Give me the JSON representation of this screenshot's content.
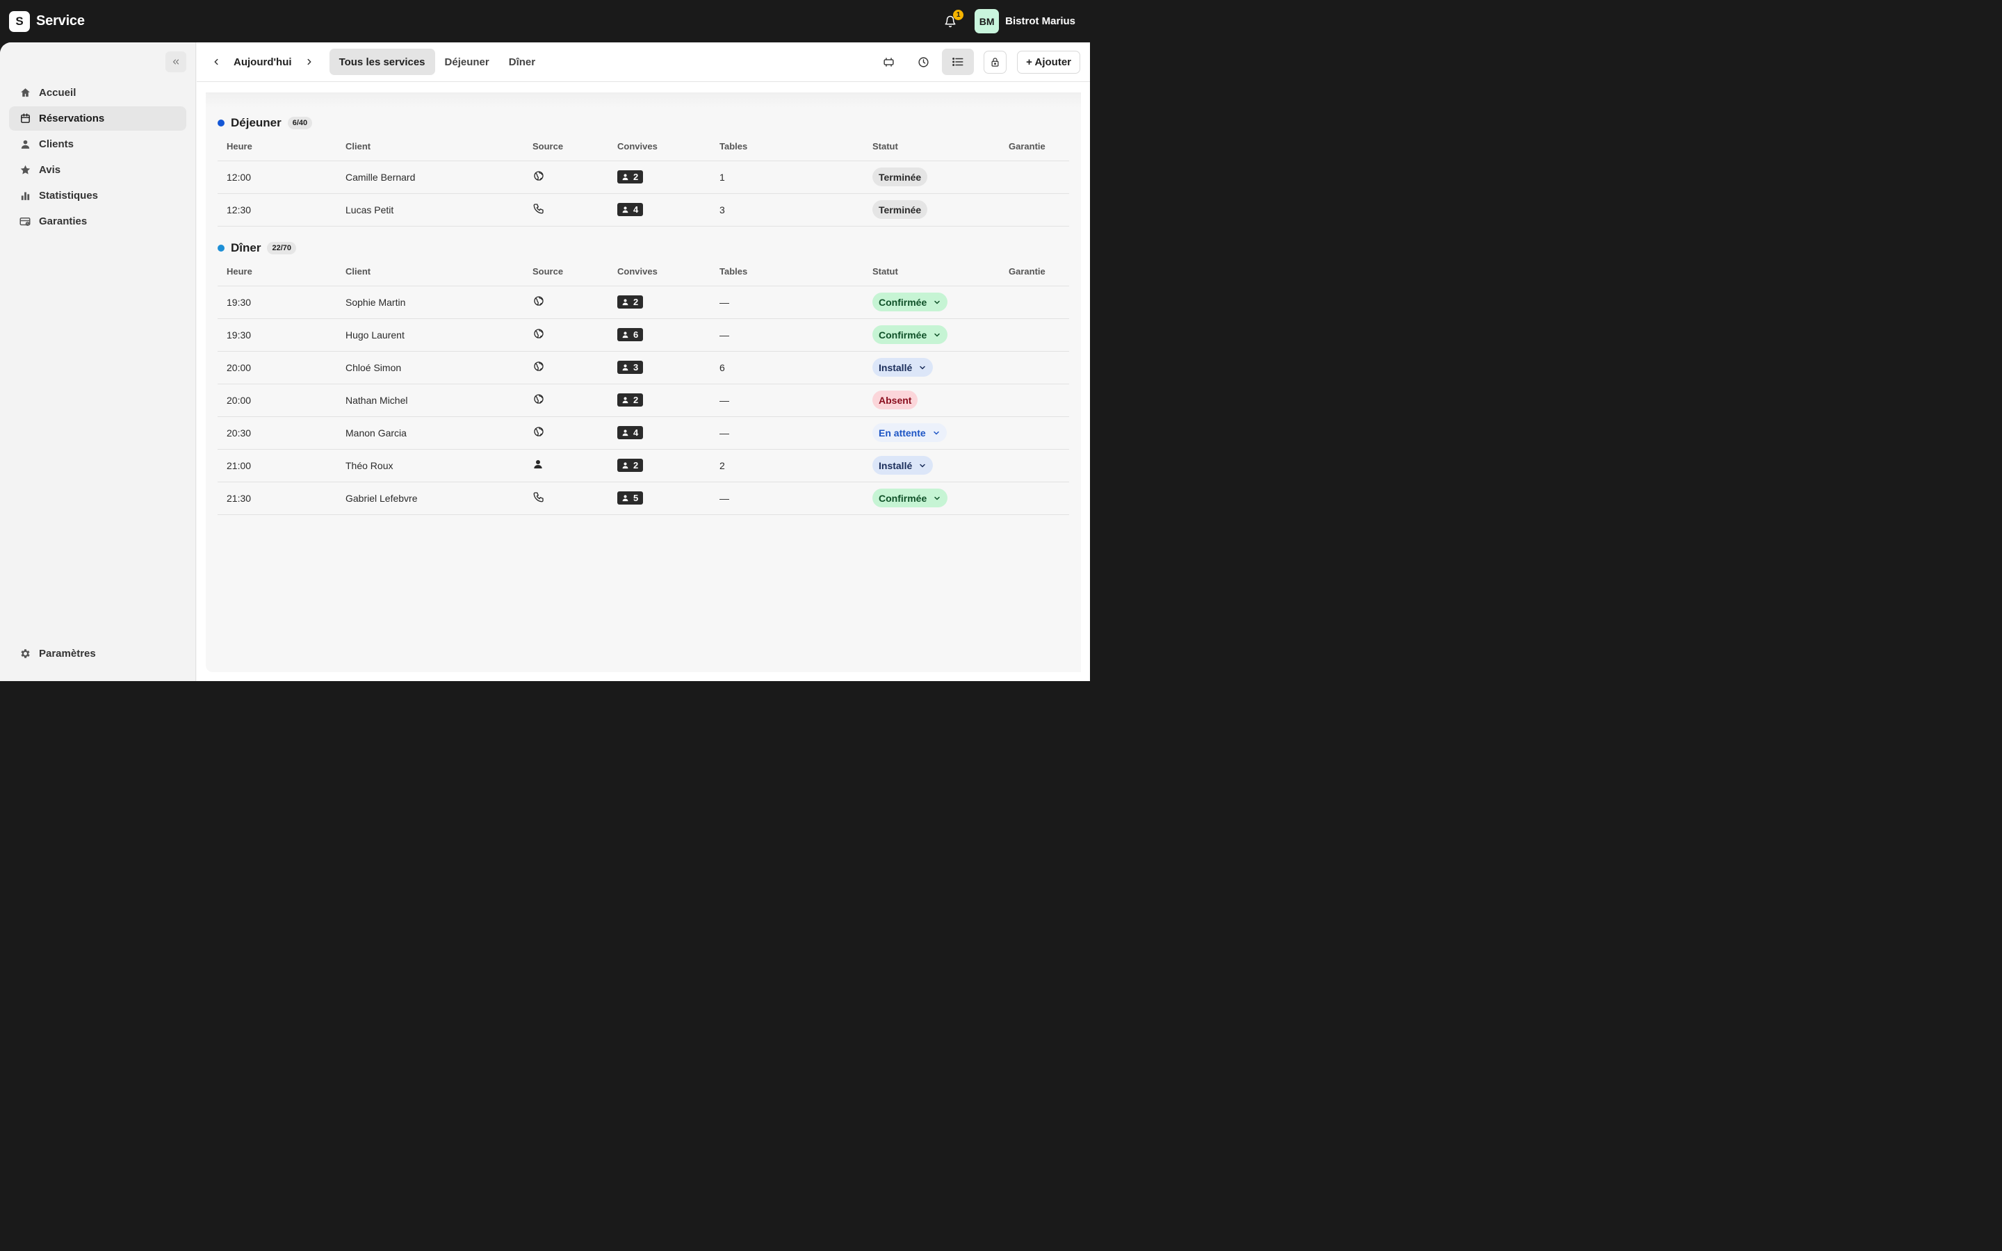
{
  "app": {
    "logo_letter": "S",
    "title": "Service"
  },
  "header": {
    "notif_count": "1",
    "avatar_initials": "BM",
    "account_name": "Bistrot Marius"
  },
  "sidebar": {
    "items": [
      {
        "label": "Accueil",
        "icon": "home-icon",
        "active": false
      },
      {
        "label": "Réservations",
        "icon": "calendar-icon",
        "active": true
      },
      {
        "label": "Clients",
        "icon": "user-icon",
        "active": false
      },
      {
        "label": "Avis",
        "icon": "star-icon",
        "active": false
      },
      {
        "label": "Statistiques",
        "icon": "bar-chart-icon",
        "active": false
      },
      {
        "label": "Garanties",
        "icon": "card-icon",
        "active": false
      }
    ],
    "settings_label": "Paramètres"
  },
  "toolbar": {
    "date_label": "Aujourd'hui",
    "tabs": [
      "Tous les services",
      "Déjeuner",
      "Dîner"
    ],
    "active_tab": 0,
    "add_label": "+ Ajouter"
  },
  "columns": [
    "Heure",
    "Client",
    "Source",
    "Convives",
    "Tables",
    "Statut",
    "Garantie"
  ],
  "services": [
    {
      "name": "Déjeuner",
      "count": "6/40",
      "color": "#1457d6",
      "rows": [
        {
          "time": "12:00",
          "client": "Camille Bernard",
          "source": "web",
          "guests": "2",
          "table": "1",
          "status": "Terminée",
          "kind": "done",
          "dropdown": false
        },
        {
          "time": "12:30",
          "client": "Lucas Petit",
          "source": "phone",
          "guests": "4",
          "table": "3",
          "status": "Terminée",
          "kind": "done",
          "dropdown": false
        }
      ]
    },
    {
      "name": "Dîner",
      "count": "22/70",
      "color": "#1d8fd6",
      "rows": [
        {
          "time": "19:30",
          "client": "Sophie Martin",
          "source": "web",
          "guests": "2",
          "table": "—",
          "status": "Confirmée",
          "kind": "conf",
          "dropdown": true
        },
        {
          "time": "19:30",
          "client": "Hugo Laurent",
          "source": "web",
          "guests": "6",
          "table": "—",
          "status": "Confirmée",
          "kind": "conf",
          "dropdown": true
        },
        {
          "time": "20:00",
          "client": "Chloé Simon",
          "source": "web",
          "guests": "3",
          "table": "6",
          "status": "Installé",
          "kind": "seated",
          "dropdown": true
        },
        {
          "time": "20:00",
          "client": "Nathan Michel",
          "source": "web",
          "guests": "2",
          "table": "—",
          "status": "Absent",
          "kind": "absent",
          "dropdown": false
        },
        {
          "time": "20:30",
          "client": "Manon Garcia",
          "source": "web",
          "guests": "4",
          "table": "—",
          "status": "En attente",
          "kind": "wait",
          "dropdown": true
        },
        {
          "time": "21:00",
          "client": "Théo Roux",
          "source": "walkin",
          "guests": "2",
          "table": "2",
          "status": "Installé",
          "kind": "seated",
          "dropdown": true
        },
        {
          "time": "21:30",
          "client": "Gabriel Lefebvre",
          "source": "phone",
          "guests": "5",
          "table": "—",
          "status": "Confirmée",
          "kind": "conf",
          "dropdown": true
        }
      ]
    }
  ]
}
